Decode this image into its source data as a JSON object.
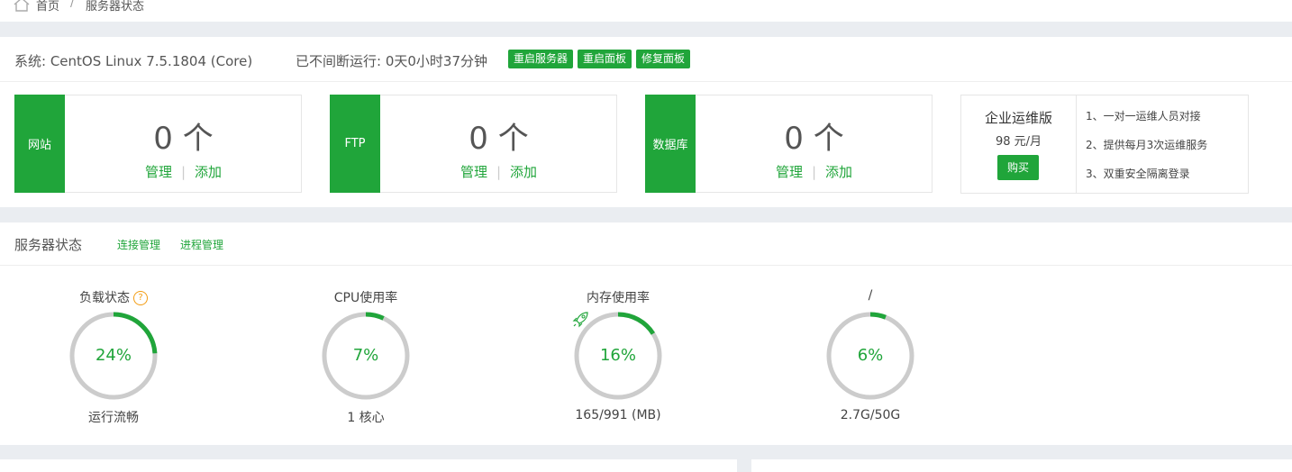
{
  "breadcrumb": {
    "home": "首页",
    "sep": "/",
    "current": "服务器状态"
  },
  "system": {
    "os": "系统: CentOS Linux 7.5.1804 (Core)",
    "uptime": "已不间断运行: 0天0小时37分钟",
    "buttons": [
      "重启服务器",
      "重启面板",
      "修复面板"
    ]
  },
  "cards": [
    {
      "name": "网站",
      "count": "0 个",
      "manage": "管理",
      "add": "添加"
    },
    {
      "name": "FTP",
      "count": "0 个",
      "manage": "管理",
      "add": "添加"
    },
    {
      "name": "数据库",
      "count": "0 个",
      "manage": "管理",
      "add": "添加"
    }
  ],
  "ad": {
    "title": "企业运维版",
    "price": "98 元/月",
    "buy": "购买",
    "features": [
      "1、一对一运维人员对接",
      "2、提供每月3次运维服务",
      "3、双重安全隔离登录"
    ]
  },
  "status": {
    "title": "服务器状态",
    "links": [
      "连接管理",
      "进程管理"
    ],
    "gauges": [
      {
        "label": "负载状态",
        "help": "?",
        "value_text": "24%",
        "percent": 24,
        "sub": "运行流畅"
      },
      {
        "label": "CPU使用率",
        "value_text": "7%",
        "percent": 7,
        "sub": "1 核心"
      },
      {
        "label": "内存使用率",
        "value_text": "16%",
        "percent": 16,
        "sub": "165/991 (MB)",
        "icon": "rocket-icon"
      },
      {
        "label": "/",
        "value_text": "6%",
        "percent": 6,
        "sub": "2.7G/50G"
      }
    ]
  },
  "colors": {
    "accent": "#20a53a",
    "ring_bg": "#cccccc",
    "help": "#f39c12"
  }
}
